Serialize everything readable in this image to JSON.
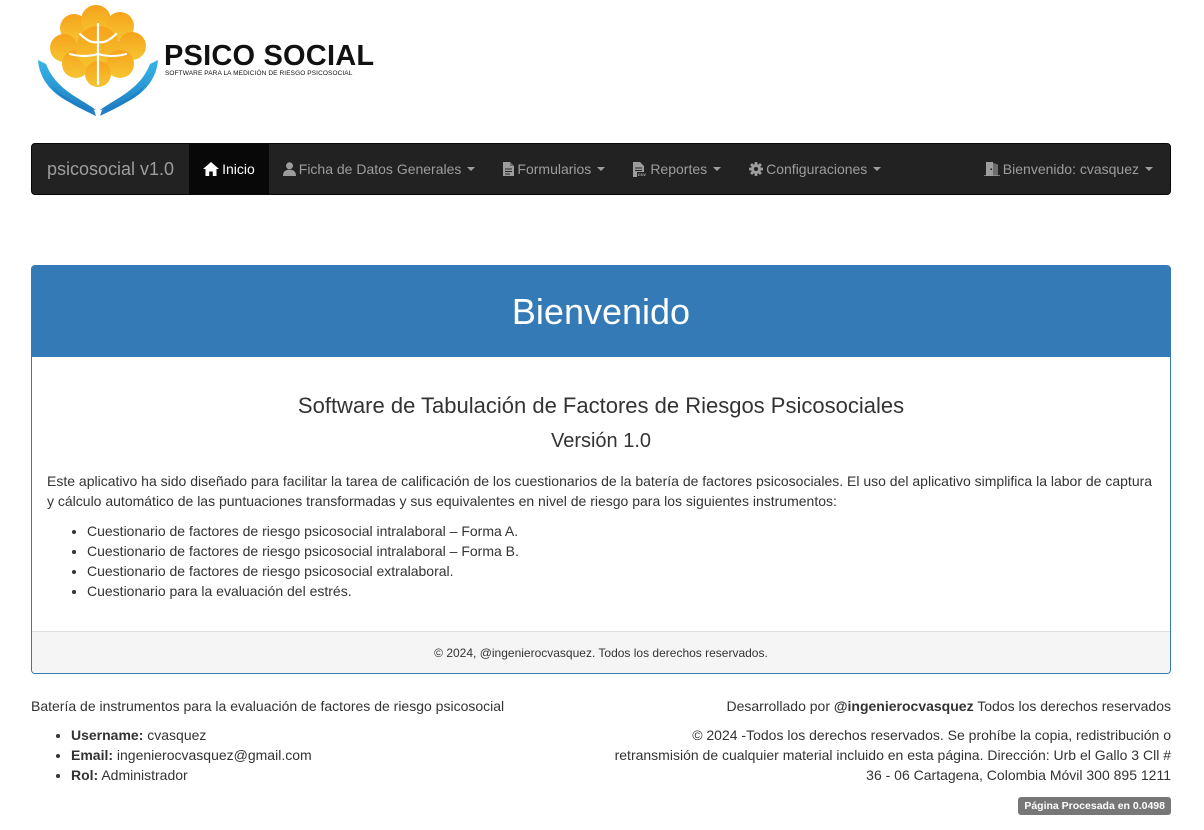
{
  "logo": {
    "title": "PSICO SOCIAL",
    "subtitle": "SOFTWARE PARA LA MEDICIÓN DE RIESGO PSICOSOCIAL"
  },
  "navbar": {
    "brand": "psicosocial v1.0",
    "items": [
      {
        "label": "Inicio",
        "icon": "home-icon",
        "active": true
      },
      {
        "label": "Ficha de Datos Generales",
        "icon": "user-icon"
      },
      {
        "label": "Formularios",
        "icon": "file-icon"
      },
      {
        "label": "Reportes",
        "icon": "csv-file-icon"
      },
      {
        "label": "Configuraciones",
        "icon": "gear-icon"
      }
    ],
    "user_menu": "Bienvenido: cvasquez"
  },
  "panel": {
    "heading": "Bienvenido",
    "title": "Software de Tabulación de Factores de Riesgos Psicosociales",
    "version": "Versión 1.0",
    "description": "Este aplicativo ha sido diseñado para facilitar la tarea de calificación de los cuestionarios de la batería de factores psicosociales. El uso del aplicativo simplifica la labor de captura y cálculo automático de las puntuaciones transformadas y sus equivalentes en nivel de riesgo para los siguientes instrumentos:",
    "instruments": [
      "Cuestionario de factores de riesgo psicosocial intralaboral – Forma A.",
      "Cuestionario de factores de riesgo psicosocial intralaboral – Forma B.",
      "Cuestionario de factores de riesgo psicosocial extralaboral.",
      "Cuestionario para la evaluación del estrés."
    ],
    "footer": "© 2024, @ingenierocvasquez. Todos los derechos reservados."
  },
  "footer": {
    "left_title": "Batería de instrumentos para la evaluación de factores de riesgo psicosocial",
    "user_info": [
      {
        "label": "Username:",
        "value": " cvasquez"
      },
      {
        "label": "Email:",
        "value": " ingenierocvasquez@gmail.com"
      },
      {
        "label": "Rol:",
        "value": " Administrador"
      }
    ],
    "developed_prefix": "Desarrollado por ",
    "developer": "@ingenierocvasquez",
    "developed_suffix": " Todos los derechos reservados",
    "rights": "© 2024 -Todos los derechos reservados. Se prohíbe la copia, redistribución o retransmisión de cualquier material incluido en esta página. Dirección: Urb el Gallo 3 Cll # 36 - 06 Cartagena, Colombia Móvil 300 895 1211",
    "processed": "Página Procesada en 0.0498"
  },
  "colors": {
    "primary": "#337ab7",
    "navbar_bg": "#222222",
    "navbar_active": "#080808",
    "navbar_text": "#9d9d9d",
    "badge_bg": "#777777"
  }
}
